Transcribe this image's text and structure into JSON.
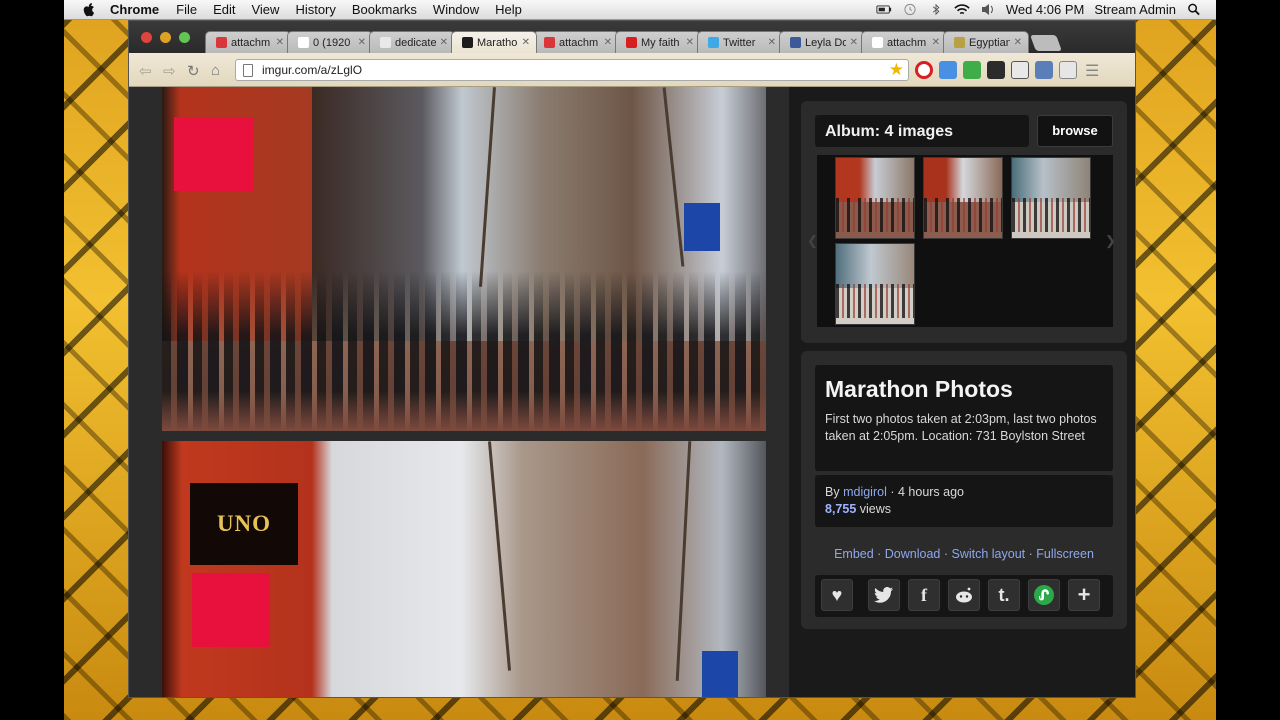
{
  "menubar": {
    "app": "Chrome",
    "menus": [
      "File",
      "Edit",
      "View",
      "History",
      "Bookmarks",
      "Window",
      "Help"
    ],
    "clock": "Wed 4:06 PM",
    "user": "Stream Admin"
  },
  "browser": {
    "tabs": [
      {
        "label": "attachm",
        "fav_color": "#d9373a"
      },
      {
        "label": "0 (1920",
        "fav_color": "#ffffff"
      },
      {
        "label": "dedicate",
        "fav_color": "#e9e9e9"
      },
      {
        "label": "Maratho",
        "fav_color": "#1c1c1c"
      },
      {
        "label": "attachm",
        "fav_color": "#d9373a"
      },
      {
        "label": "My faith",
        "fav_color": "#d81f1f"
      },
      {
        "label": "Twitter",
        "fav_color": "#3fa9e8"
      },
      {
        "label": "Leyla Do",
        "fav_color": "#3b5a9a"
      },
      {
        "label": "attachm",
        "fav_color": "#ffffff"
      },
      {
        "label": "Egyptian",
        "fav_color": "#b8a144"
      }
    ],
    "active_tab": 3,
    "url": "imgur.com/a/zLglO"
  },
  "album": {
    "header": "Album: 4 images",
    "browse_label": "browse",
    "title": "Marathon Photos",
    "description": "First two photos taken at 2:03pm, last two photos taken at 2:05pm. Location: 731 Boylston Street",
    "by_prefix": "By",
    "user": "mdigirol",
    "time": "4 hours ago",
    "views": "8,755",
    "views_label": "views",
    "actions": [
      "Embed",
      "Download",
      "Switch layout",
      "Fullscreen"
    ]
  },
  "photo": {
    "sign_text": "UNO"
  },
  "colors": {
    "link": "#8fa7ee",
    "panel": "#2b2b2b",
    "box": "#151515"
  },
  "share_icons": [
    "heart-icon",
    "twitter-icon",
    "facebook-icon",
    "reddit-icon",
    "tumblr-icon",
    "stumbleupon-icon",
    "plus-icon"
  ]
}
